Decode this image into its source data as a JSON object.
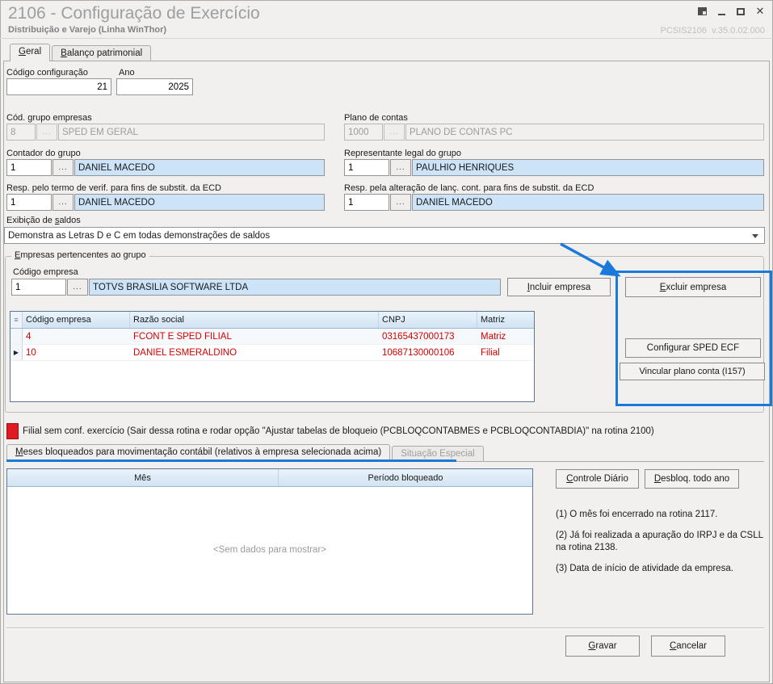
{
  "window": {
    "title": "2106 - Configuração de Exercício",
    "subtitle": "Distribuição e Varejo (Linha WinThor)",
    "version": "PCSIS2106  v.35.0.02.000",
    "icons": {
      "close": "✕"
    }
  },
  "tabs": {
    "geral": "Geral",
    "balanco": "Balanço patrimonial"
  },
  "form": {
    "dots": "...",
    "codigo_configuracao": {
      "label": "Código configuração",
      "value": "21"
    },
    "ano": {
      "label": "Ano",
      "value": "2025"
    },
    "grupo_empresas": {
      "label": "Cód. grupo empresas",
      "code": "8",
      "name": "SPED EM GERAL"
    },
    "plano_contas": {
      "label": "Plano de contas",
      "code": "1000",
      "name": "PLANO DE CONTAS PC"
    },
    "contador": {
      "label": "Contador do grupo",
      "code": "1",
      "name": "DANIEL MACEDO"
    },
    "representante": {
      "label": "Representante legal do grupo",
      "code": "1",
      "name": "PAULHIO HENRIQUES"
    },
    "resp_termo": {
      "label": "Resp. pelo termo de verif. para fins de substit. da ECD",
      "code": "1",
      "name": "DANIEL MACEDO"
    },
    "resp_alteracao": {
      "label": "Resp. pela alteração de lanç. cont. para fins de substit. da ECD",
      "code": "1",
      "name": "DANIEL MACEDO"
    },
    "exibicao_saldos": {
      "label": "Exibição de saldos",
      "value": "Demonstra as Letras D e C em todas demonstrações de saldos"
    }
  },
  "empresas": {
    "group_title": "Empresas pertencentes ao grupo",
    "codigo_label": "Código empresa",
    "codigo_value": "1",
    "empresa_nome": "TOTVS BRASILIA SOFTWARE LTDA",
    "buttons": {
      "incluir": "Incluir empresa",
      "excluir": "Excluir empresa",
      "configurar_sped": "Configurar SPED ECF",
      "vincular_plano": "Vincular plano conta (I157)"
    },
    "grid": {
      "header_icon": "≡",
      "selected_indicator": "▶",
      "columns": [
        "Código empresa",
        "Razão social",
        "CNPJ",
        "Matriz"
      ],
      "rows": [
        {
          "codigo": "4",
          "razao_social": "FCONT E SPED FILIAL",
          "cnpj": "03165437000173",
          "matriz": "Matriz"
        },
        {
          "codigo": "10",
          "razao_social": "DANIEL ESMERALDINO",
          "cnpj": "10687130000106",
          "matriz": "Filial"
        }
      ]
    }
  },
  "warning": {
    "text": "Filial sem conf. exercício (Sair dessa rotina e rodar opção \"Ajustar tabelas de bloqueio (PCBLOQCONTABMES e PCBLOQCONTABDIA)\" na rotina 2100)"
  },
  "meses": {
    "tab_meses": "Meses bloqueados para movimentação contábil (relativos à empresa selecionada acima)",
    "tab_situacao": "Situação Especial",
    "grid": {
      "columns": [
        "Mês",
        "Período bloqueado"
      ],
      "empty_text": "<Sem dados para mostrar>"
    },
    "buttons": {
      "controle_diario": "Controle Diário",
      "desbloq_ano": "Desbloq. todo ano"
    },
    "notes": [
      "(1)  O mês foi encerrado na rotina 2117.",
      "(2)  Já foi realizada a apuração do IRPJ e da CSLL na rotina 2138.",
      "(3)  Data de início de atividade da empresa."
    ]
  },
  "footer": {
    "gravar": "Gravar",
    "cancelar": "Cancelar"
  },
  "colors": {
    "annotation_blue": "#1B7AD9",
    "grid_text_red": "#D40000",
    "lookup_blue": "#CDE3F8"
  }
}
